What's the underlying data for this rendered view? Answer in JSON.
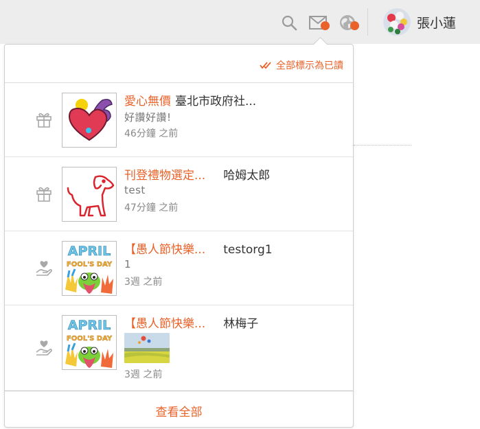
{
  "header": {
    "user_name": "張小蓮",
    "icons": [
      "search-icon",
      "mail-icon",
      "globe-icon"
    ],
    "accent": "#e8622a"
  },
  "panel": {
    "mark_all_read": "全部標示為已讀",
    "view_all": "查看全部",
    "notifications": [
      {
        "type_icon": "gift-icon",
        "thumb": "heart-muscle",
        "title": "愛心無價",
        "actor": "臺北市政府社...",
        "body": "好讚好讚!",
        "time": "46分鐘 之前"
      },
      {
        "type_icon": "gift-icon",
        "thumb": "dog",
        "title": "刊登禮物選定...",
        "actor": "哈姆太郎",
        "body": "test",
        "time": "47分鐘 之前"
      },
      {
        "type_icon": "hand-heart-icon",
        "thumb": "april-fools",
        "title": "【愚人節快樂...",
        "actor": "testorg1",
        "body": "1",
        "time": "3週 之前"
      },
      {
        "type_icon": "hand-heart-icon",
        "thumb": "april-fools",
        "title": "【愚人節快樂...",
        "actor": "林梅子",
        "body": "",
        "time": "3週 之前",
        "attachment": "balloon-photo"
      }
    ]
  }
}
